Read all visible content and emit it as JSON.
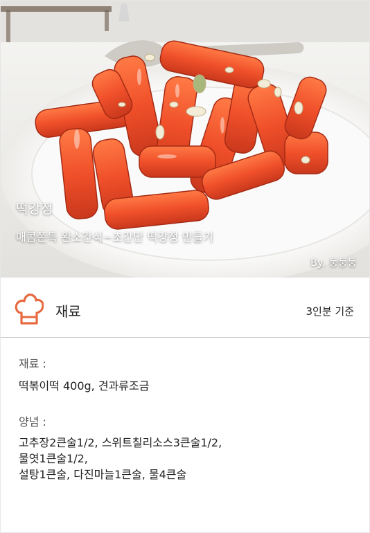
{
  "hero": {
    "title": "떡강정",
    "subtitle": "매콤쫀득 완소간식~초간단 떡강정 만들기",
    "byline": "By.  둥둥둥"
  },
  "section": {
    "icon": "chef-hat-icon",
    "title": "재료",
    "serving": "3인분 기준",
    "accent_color": "#e8693f"
  },
  "ingredients": {
    "label": "재료 :",
    "text": "떡볶이떡 400g, 견과류조금"
  },
  "seasoning": {
    "label": "양념 :",
    "lines": [
      "고추장2큰술1/2, 스위트칠리소스3큰술1/2,",
      "물엿1큰술1/2,",
      "설탕1큰술, 다진마늘1큰술, 물4큰술"
    ]
  }
}
